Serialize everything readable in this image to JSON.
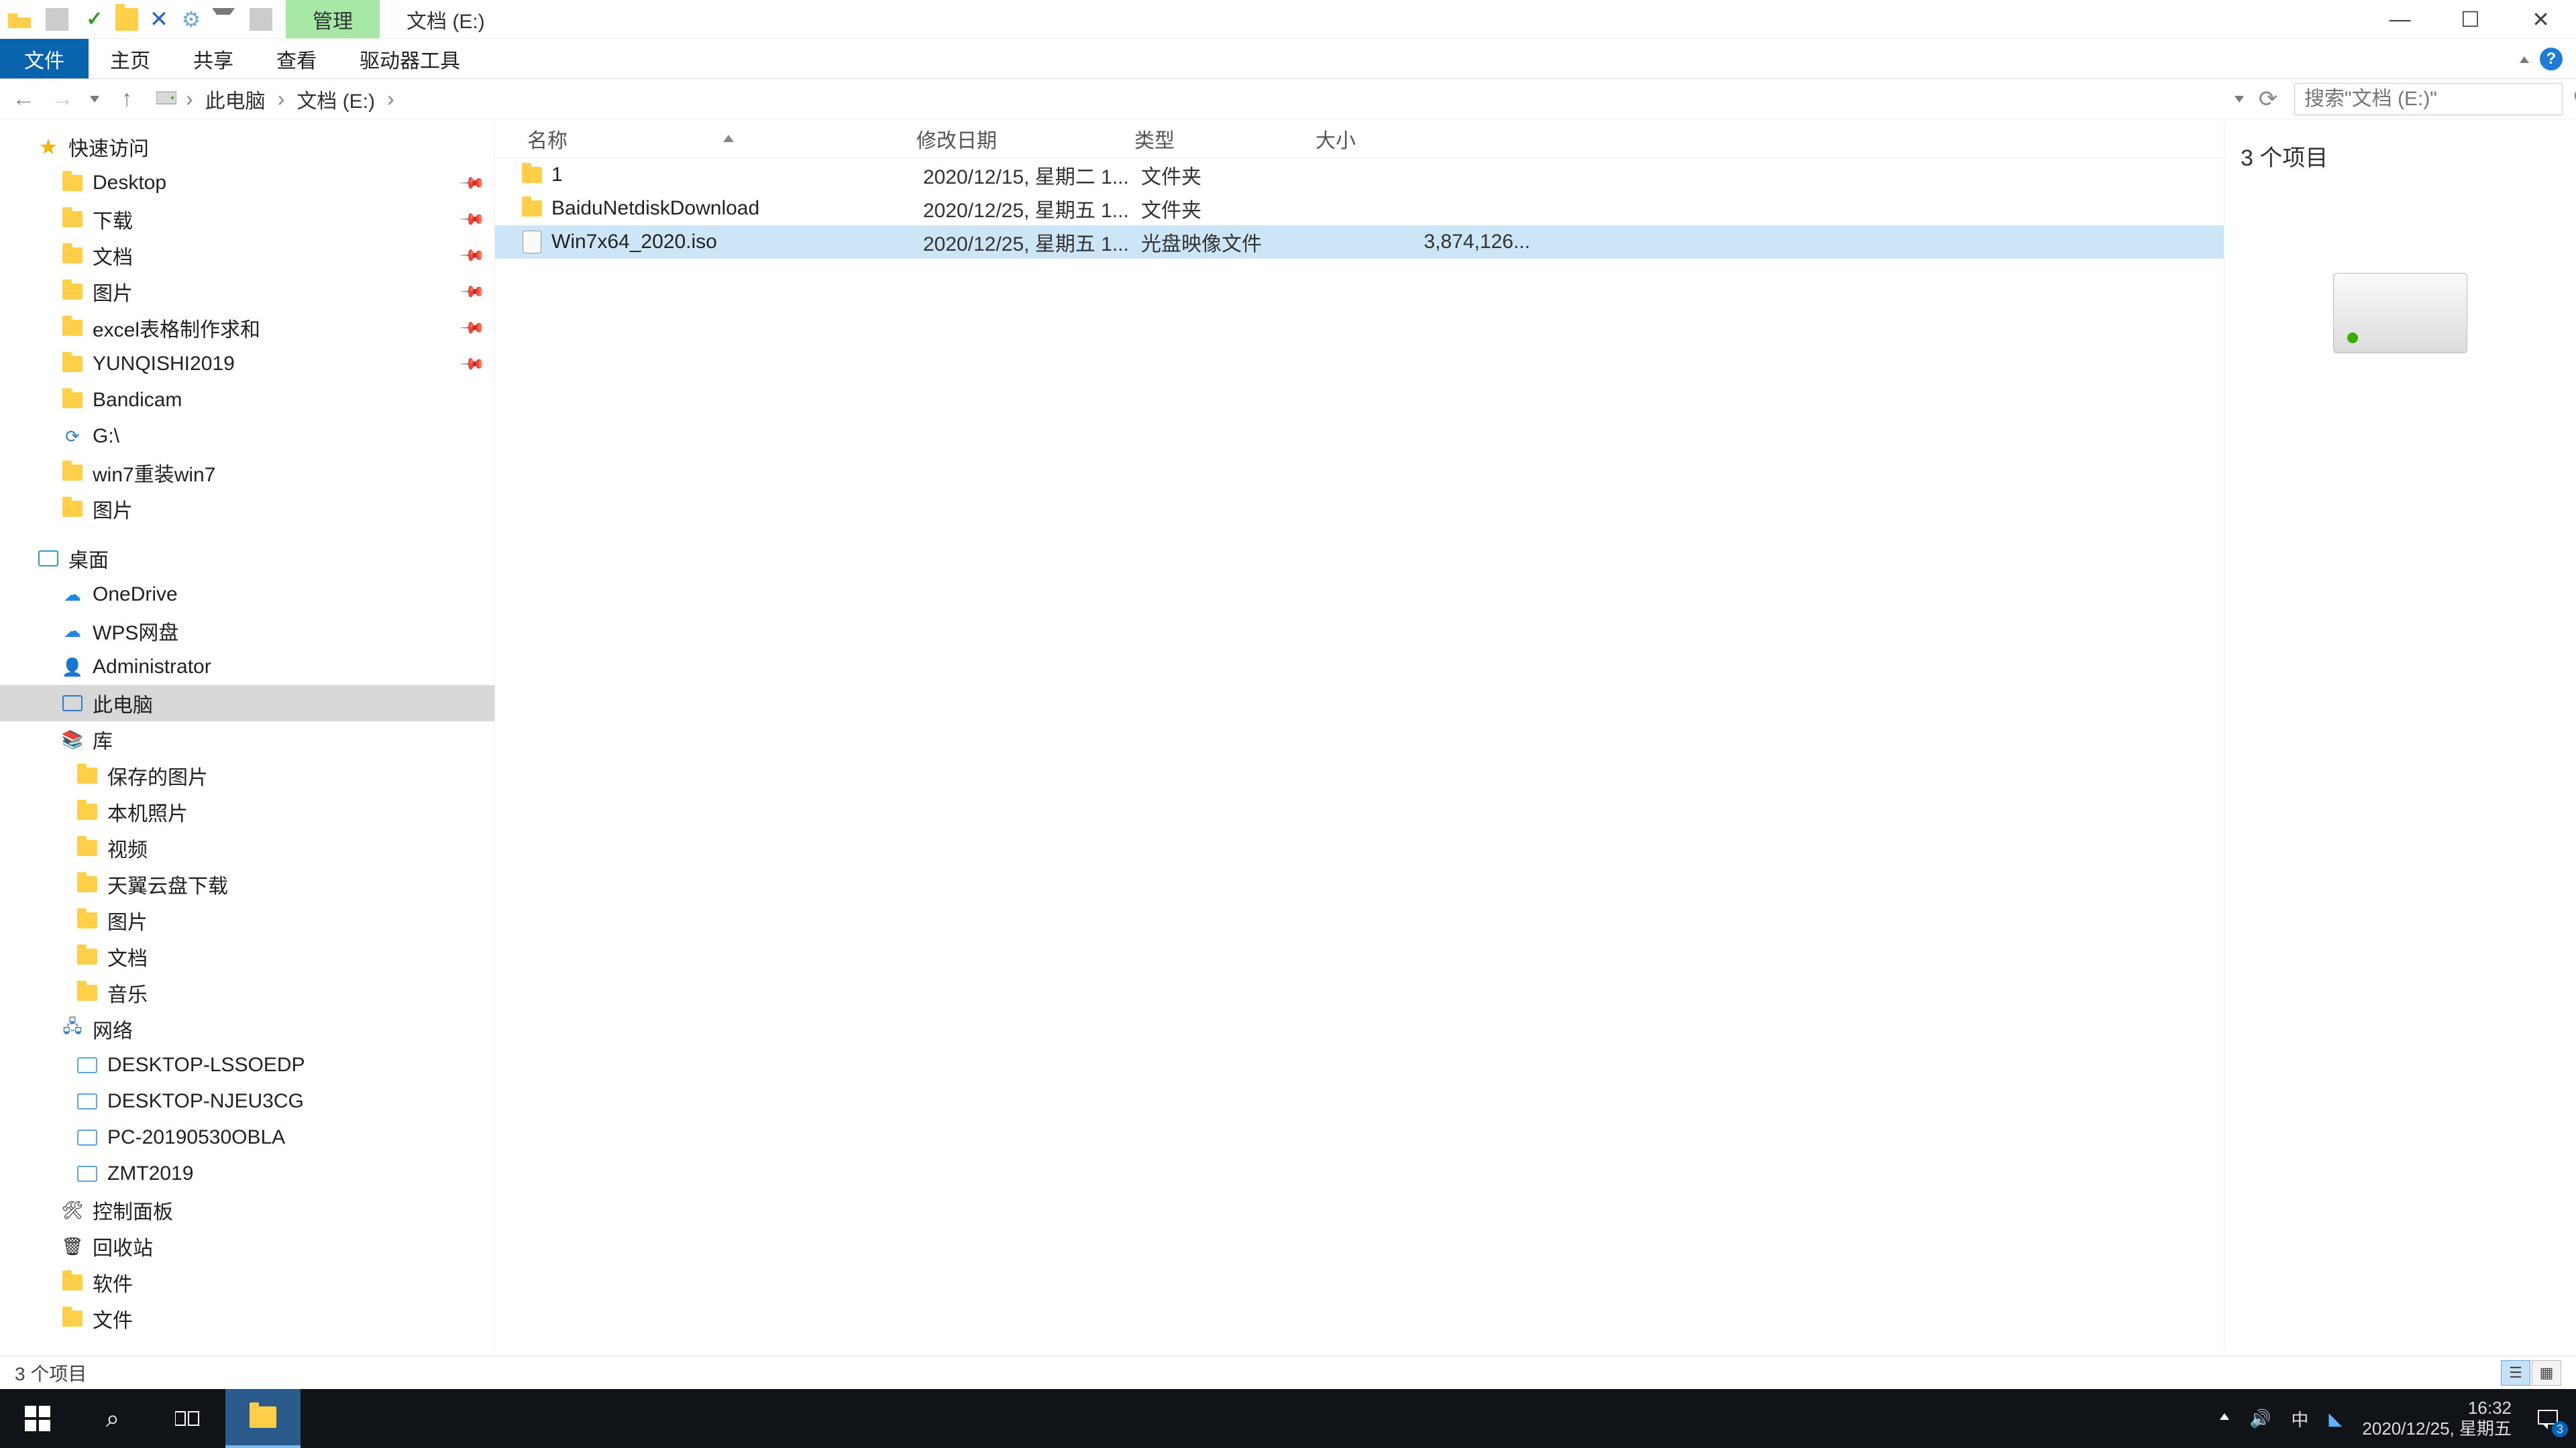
{
  "titlebar": {
    "context_tab": "管理",
    "location_title": "文档 (E:)"
  },
  "ribbon": {
    "file": "文件",
    "home": "主页",
    "share": "共享",
    "view": "查看",
    "drive_tools": "驱动器工具"
  },
  "breadcrumb": {
    "pc": "此电脑",
    "drive": "文档 (E:)"
  },
  "search": {
    "placeholder": "搜索\"文档 (E:)\""
  },
  "columns": {
    "name": "名称",
    "date": "修改日期",
    "type": "类型",
    "size": "大小"
  },
  "files": [
    {
      "name": "1",
      "date": "2020/12/15, 星期二 1...",
      "type": "文件夹",
      "size": "",
      "icon": "folder"
    },
    {
      "name": "BaiduNetdiskDownload",
      "date": "2020/12/25, 星期五 1...",
      "type": "文件夹",
      "size": "",
      "icon": "folder"
    },
    {
      "name": "Win7x64_2020.iso",
      "date": "2020/12/25, 星期五 1...",
      "type": "光盘映像文件",
      "size": "3,874,126...",
      "icon": "iso",
      "selected": true
    }
  ],
  "preview": {
    "title": "3 个项目"
  },
  "tree": {
    "quick": "快速访问",
    "quick_items": [
      {
        "label": "Desktop",
        "pin": true,
        "icon": "folder-blue"
      },
      {
        "label": "下载",
        "pin": true,
        "icon": "folder-blue"
      },
      {
        "label": "文档",
        "pin": true,
        "icon": "folder-blue"
      },
      {
        "label": "图片",
        "pin": true,
        "icon": "folder-blue"
      },
      {
        "label": "excel表格制作求和",
        "pin": true,
        "icon": "folder"
      },
      {
        "label": "YUNQISHI2019",
        "pin": true,
        "icon": "folder"
      },
      {
        "label": "Bandicam",
        "pin": false,
        "icon": "folder"
      },
      {
        "label": "G:\\",
        "pin": false,
        "icon": "app"
      },
      {
        "label": "win7重装win7",
        "pin": false,
        "icon": "folder"
      },
      {
        "label": "图片",
        "pin": false,
        "icon": "folder"
      }
    ],
    "desktop": "桌面",
    "desktop_items": [
      {
        "label": "OneDrive",
        "icon": "cloud"
      },
      {
        "label": "WPS网盘",
        "icon": "cloud-blue"
      },
      {
        "label": "Administrator",
        "icon": "user"
      },
      {
        "label": "此电脑",
        "icon": "pc",
        "selected": true
      },
      {
        "label": "库",
        "icon": "library"
      },
      {
        "label": "保存的图片",
        "icon": "pics",
        "indent": true
      },
      {
        "label": "本机照片",
        "icon": "pics",
        "indent": true
      },
      {
        "label": "视频",
        "icon": "video",
        "indent": true
      },
      {
        "label": "天翼云盘下载",
        "icon": "download",
        "indent": true
      },
      {
        "label": "图片",
        "icon": "pics",
        "indent": true
      },
      {
        "label": "文档",
        "icon": "docs",
        "indent": true
      },
      {
        "label": "音乐",
        "icon": "music",
        "indent": true
      },
      {
        "label": "网络",
        "icon": "network"
      },
      {
        "label": "DESKTOP-LSSOEDP",
        "icon": "netpc",
        "indent": true
      },
      {
        "label": "DESKTOP-NJEU3CG",
        "icon": "netpc",
        "indent": true
      },
      {
        "label": "PC-20190530OBLA",
        "icon": "netpc",
        "indent": true
      },
      {
        "label": "ZMT2019",
        "icon": "netpc",
        "indent": true
      },
      {
        "label": "控制面板",
        "icon": "control"
      },
      {
        "label": "回收站",
        "icon": "recycle"
      },
      {
        "label": "软件",
        "icon": "folder"
      },
      {
        "label": "文件",
        "icon": "folder"
      }
    ]
  },
  "statusbar": {
    "count": "3 个项目"
  },
  "taskbar": {
    "time": "16:32",
    "date": "2020/12/25, 星期五",
    "ime": "中",
    "notif_count": "3"
  }
}
